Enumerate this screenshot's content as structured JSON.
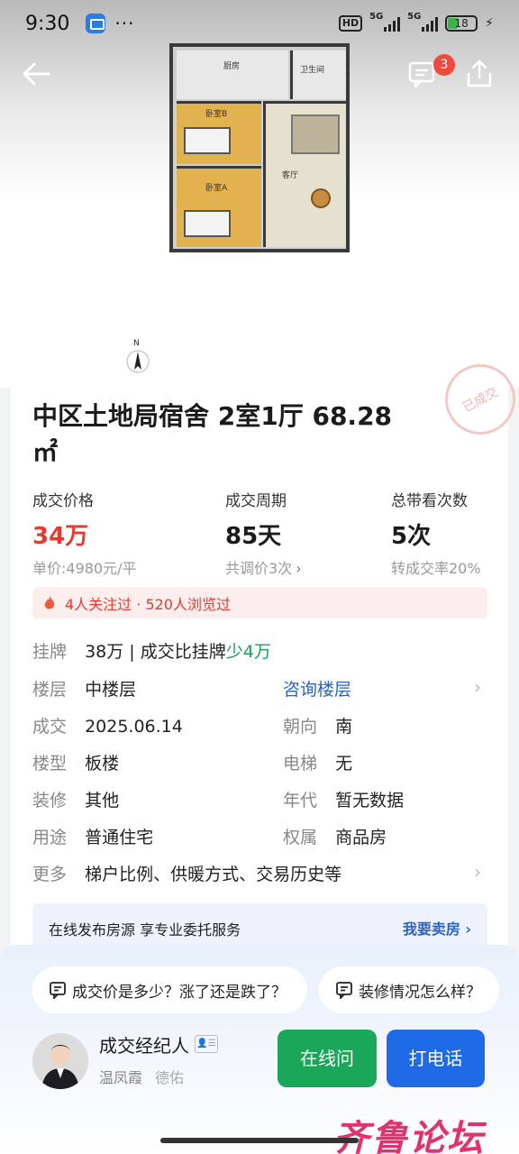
{
  "status": {
    "time": "9:30",
    "dots": "···",
    "hd": "HD",
    "net1": "5G",
    "net2": "5G",
    "battery": "18"
  },
  "nav": {
    "badge": "3"
  },
  "floorplan": {
    "kitchen": "厨房",
    "bath": "卫生间",
    "bedB": "卧室B",
    "bedA": "卧室A",
    "living": "客厅"
  },
  "compass": "N",
  "stamp": "已成交",
  "title": "中区土地局宿舍 2室1厅 68.28㎡",
  "stats": [
    {
      "label": "成交价格",
      "value": "34万",
      "sub": "单价:4980元/平"
    },
    {
      "label": "成交周期",
      "value": "85天",
      "sub": "共调价3次"
    },
    {
      "label": "总带看次数",
      "value": "5次",
      "sub": "转成交率20%"
    }
  ],
  "heat": "4人关注过 · 520人浏览过",
  "listing": {
    "key": "挂牌",
    "value": "38万 | 成交比挂牌",
    "diff": "少4万"
  },
  "details": {
    "floor_k": "楼层",
    "floor_v": "中楼层",
    "floor_link": "咨询楼层",
    "deal_k": "成交",
    "deal_v": "2025.06.14",
    "orient_k": "朝向",
    "orient_v": "南",
    "type_k": "楼型",
    "type_v": "板楼",
    "elev_k": "电梯",
    "elev_v": "无",
    "deco_k": "装修",
    "deco_v": "其他",
    "year_k": "年代",
    "year_v": "暂无数据",
    "use_k": "用途",
    "use_v": "普通住宅",
    "own_k": "权属",
    "own_v": "商品房",
    "more_k": "更多",
    "more_v": "梯户比例、供暖方式、交易历史等"
  },
  "banner": {
    "text": "在线发布房源 享专业委托服务",
    "link": "我要卖房"
  },
  "questions": [
    "成交价是多少？涨了还是跌了？",
    "装修情况怎么样？"
  ],
  "agent": {
    "title": "成交经纪人",
    "name": "温凤霞",
    "company": "德佑"
  },
  "buttons": {
    "online": "在线问",
    "call": "打电话"
  },
  "watermark": "齐鲁论坛"
}
